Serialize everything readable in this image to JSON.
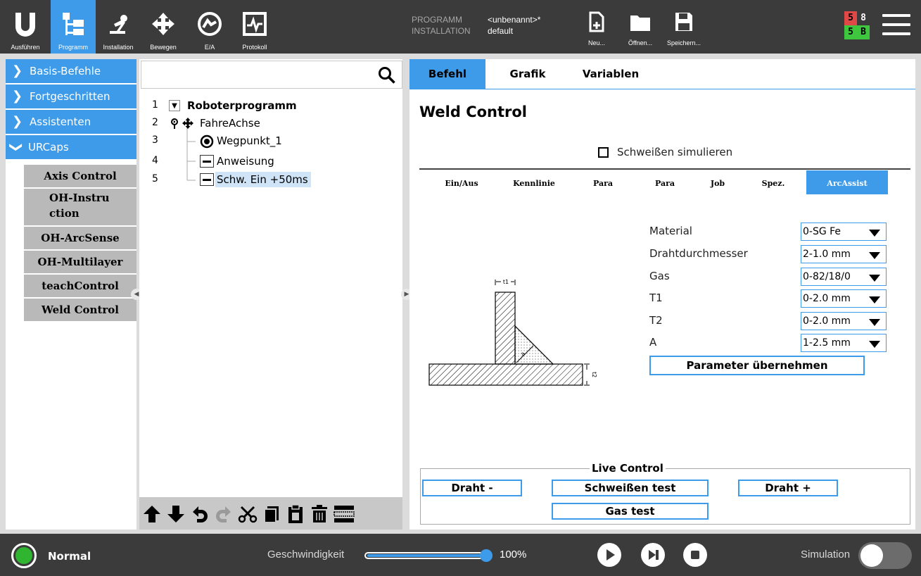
{
  "nav": {
    "items": [
      {
        "label": "Ausführen",
        "icon": "ur-logo-icon"
      },
      {
        "label": "Programm",
        "icon": "program-tree-icon"
      },
      {
        "label": "Installation",
        "icon": "robot-arm-icon"
      },
      {
        "label": "Bewegen",
        "icon": "move-arrows-icon"
      },
      {
        "label": "E/A",
        "icon": "io-icon"
      },
      {
        "label": "Protokoll",
        "icon": "log-icon"
      }
    ]
  },
  "program_info": {
    "program_key": "PROGRAMM",
    "program_value": "<unbenannt>*",
    "installation_key": "INSTALLATION",
    "installation_value": "default"
  },
  "file_actions": {
    "new_label": "Neu...",
    "open_label": "Öffnen...",
    "save_label": "Speichern..."
  },
  "io_status": {
    "a": "5",
    "b": "8",
    "c": "5",
    "d": "B"
  },
  "sidebar": {
    "categories": [
      "Basis-Befehle",
      "Fortgeschritten",
      "Assistenten",
      "URCaps"
    ],
    "urcaps": [
      "Axis Control",
      "OH-Instruction",
      "OH-ArcSense",
      "OH-Multilayer",
      "teachControl",
      "Weld Control"
    ]
  },
  "search": {
    "placeholder": ""
  },
  "tree": {
    "lines": [
      {
        "num": "1",
        "label": "Roboterprogramm"
      },
      {
        "num": "2",
        "label": "FahreAchse"
      },
      {
        "num": "3",
        "label": "Wegpunkt_1"
      },
      {
        "num": "4",
        "label": "Anweisung"
      },
      {
        "num": "5",
        "label": "Schw. Ein +50ms"
      }
    ]
  },
  "tabs": {
    "command": "Befehl",
    "graphic": "Grafik",
    "variables": "Variablen"
  },
  "weld": {
    "title": "Weld Control",
    "simulate_label": "Schweißen simulieren",
    "simulate_checked": false,
    "subtabs": [
      "Ein/Aus",
      "Kennlinie",
      "Para",
      "Para",
      "Job",
      "Spez.",
      "ArcAssist"
    ],
    "active_subtab": "ArcAssist",
    "params": [
      {
        "label": "Material",
        "value": "0-SG Fe"
      },
      {
        "label": "Drahtdurchmesser",
        "value": "2-1.0 mm"
      },
      {
        "label": "Gas",
        "value": "0-82/18/0"
      },
      {
        "label": "T1",
        "value": "0-2.0 mm"
      },
      {
        "label": "T2",
        "value": "0-2.0 mm"
      },
      {
        "label": "A",
        "value": "1-2.5 mm"
      }
    ],
    "apply_label": "Parameter übernehmen",
    "diagram": {
      "t1_label": "t1",
      "t2_label": "t2",
      "a_label": "a"
    },
    "live_control": {
      "title": "Live Control",
      "wire_minus": "Draht -",
      "weld_test": "Schweißen test",
      "wire_plus": "Draht +",
      "gas_test": "Gas test"
    }
  },
  "bottom": {
    "status": "Normal",
    "speed_label": "Geschwindigkeit",
    "speed_value": "100%",
    "speed_fraction": 1.0,
    "simulation_label": "Simulation",
    "simulation_on": false
  },
  "colors": {
    "accent": "#3d9be9",
    "topbar": "#3b3b3b",
    "status_green": "#2fb52f",
    "io_red": "#e04848",
    "io_green": "#3ec63e"
  }
}
